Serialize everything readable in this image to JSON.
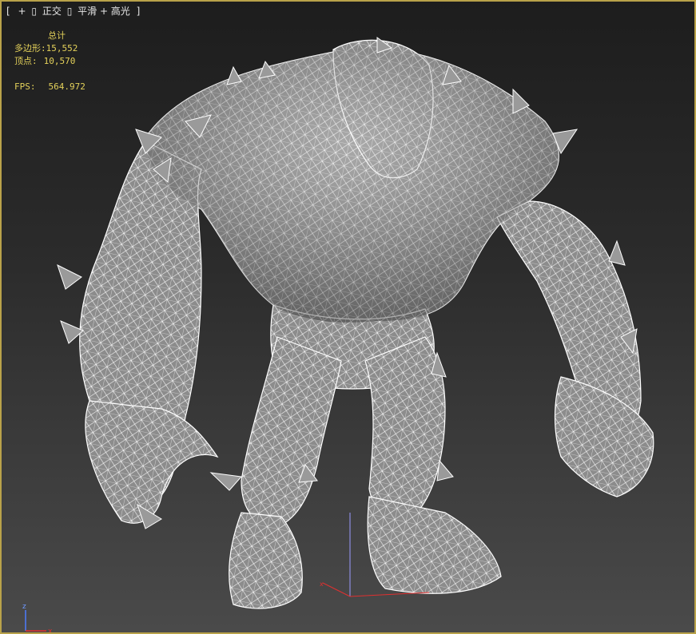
{
  "viewport": {
    "label_open": "[",
    "plus": "+",
    "view": "正交",
    "shading": "平滑 + 高光",
    "label_close": "]"
  },
  "stats": {
    "title": "总计",
    "polygons_label": "多边形:",
    "polygons_value": "15,552",
    "vertices_label": "顶点:",
    "vertices_value": "10,570",
    "fps_label": "FPS:",
    "fps_value": "564.972"
  },
  "axes": {
    "z": "z",
    "x": "x"
  },
  "colors": {
    "frame": "#b9a24a",
    "stats_text": "#e4d15a",
    "wire": "#ffffff",
    "model_fill": "#8a8a8a"
  },
  "icons": [
    "brackets",
    "wireframe-model",
    "axis-tripod"
  ]
}
